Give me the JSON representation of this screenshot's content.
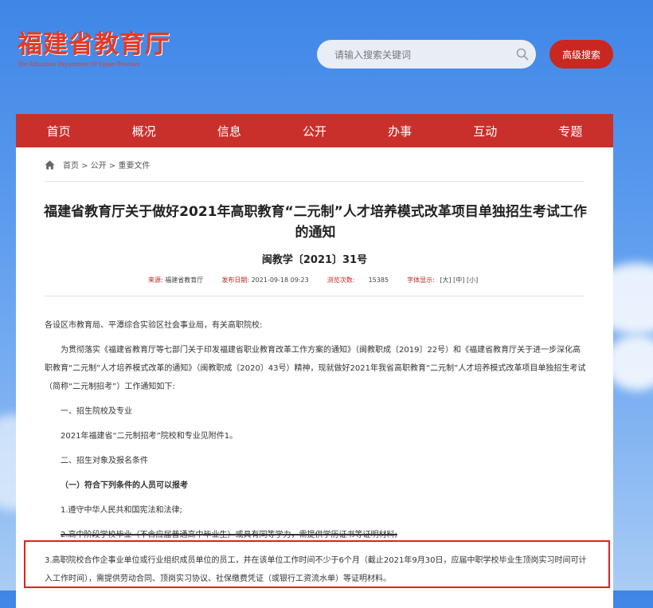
{
  "header": {
    "logo_cn": "福建省教育厅",
    "logo_en": "The Education Department Of Fujian Province",
    "search_placeholder": "请输入搜索关键词",
    "advanced_search": "高级搜索"
  },
  "nav": [
    "首页",
    "概况",
    "信息",
    "公开",
    "办事",
    "互动",
    "专题"
  ],
  "breadcrumb": "首页 > 公开 > 重要文件",
  "article": {
    "title": "福建省教育厅关于做好2021年高职教育“二元制”人才培养模式改革项目单独招生考试工作的通知",
    "doc_no": "闽教学〔2021〕31号",
    "meta": {
      "source_label": "来源:",
      "source": "福建省教育厅",
      "date_label": "发布日期:",
      "date": "2021-09-18 09:23",
      "views_label": "浏览次数:",
      "views": "15385",
      "font_label": "字体显示:",
      "font_large": "[大]",
      "font_medium": "[中]",
      "font_small": "[小]"
    },
    "paragraphs": {
      "greeting": "各设区市教育局、平潭综合实验区社会事业局，有关高职院校:",
      "intro": "为贯彻落实《福建省教育厅等七部门关于印发福建省职业教育改革工作方案的通知》（闽教职成〔2019〕22号）和《福建省教育厅关于进一步深化高职教育“二元制”人才培养模式改革的通知》（闽教职成〔2020〕43号）精神，现就做好2021年我省高职教育“二元制”人才培养模式改革项目单独招生考试（简称“二元制招考”）工作通知如下:",
      "s1": "一、招生院校及专业",
      "s1_text": "2021年福建省“二元制招考”院校和专业见附件1。",
      "s2": "二、招生对象及报名条件",
      "s2_sub": "（一）符合下列条件的人员可以报考",
      "item1": "1.遵守中华人民共和国宪法和法律;",
      "item2": "2.高中阶段学校毕业（不含应届普通高中毕业生）或具有同等学力，需提供学历证书等证明材料;",
      "item3": "3.高职院校合作企事业单位或行业组织成员单位的员工，并在该单位工作时间不少于6个月（截止2021年9月30日，应届中职学校毕业生顶岗实习时间可计入工作时间），需提供劳动合同、顶岗实习协议、社保缴费凭证（或银行工资流水单）等证明材料。"
    }
  }
}
